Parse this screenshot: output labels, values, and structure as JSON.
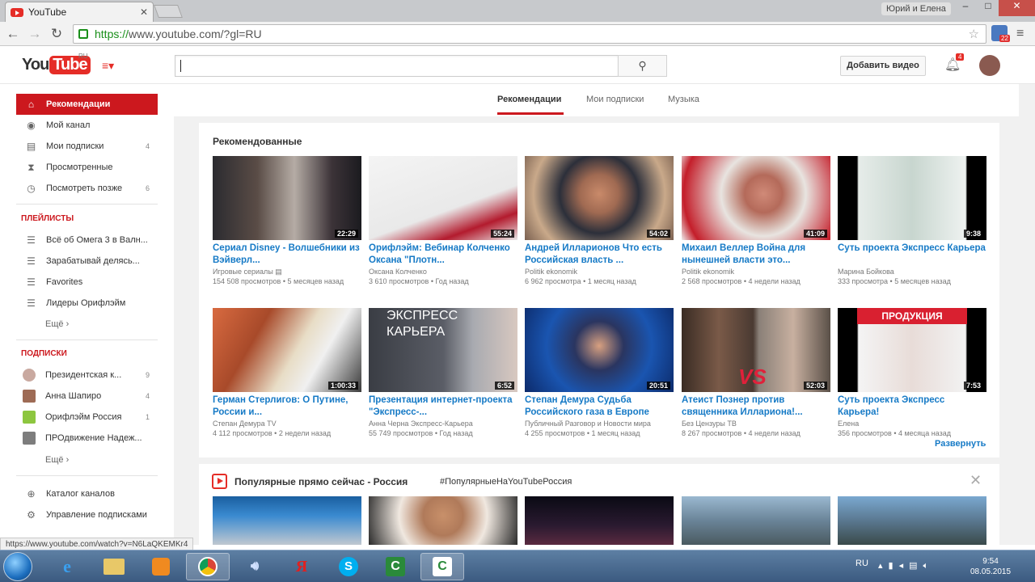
{
  "browser": {
    "tab_title": "YouTube",
    "tab_close": "✕",
    "user_chip": "Юрий и Елена",
    "url_https": "https://",
    "url_rest": "www.youtube.com/?gl=RU",
    "extension_badge": "22",
    "status_url": "https://www.youtube.com/watch?v=N6LaQKEMKr4"
  },
  "header": {
    "logo_you": "You",
    "logo_tube": "Tube",
    "logo_region": "RU",
    "search_value": "",
    "upload_label": "Добавить видео",
    "notification_count": "4"
  },
  "sidebar": {
    "main": [
      {
        "label": "Рекомендации",
        "icon": "home-icon",
        "count": ""
      },
      {
        "label": "Мой канал",
        "icon": "user-icon",
        "count": ""
      },
      {
        "label": "Мои подписки",
        "icon": "subscriptions-icon",
        "count": "4"
      },
      {
        "label": "Просмотренные",
        "icon": "hourglass-icon",
        "count": ""
      },
      {
        "label": "Посмотреть позже",
        "icon": "clock-icon",
        "count": "6"
      }
    ],
    "playlists_header": "ПЛЕЙЛИСТЫ",
    "playlists": [
      {
        "label": "Всё об Омега 3 в Валн...",
        "count": ""
      },
      {
        "label": "Зарабатывай делясь...",
        "count": ""
      },
      {
        "label": "Favorites",
        "count": ""
      },
      {
        "label": "Лидеры Орифлэйм",
        "count": ""
      }
    ],
    "more_label": "Ещё",
    "subs_header": "ПОДПИСКИ",
    "subscriptions": [
      {
        "label": "Президентская к...",
        "count": "9"
      },
      {
        "label": "Анна Шапиро",
        "count": "4"
      },
      {
        "label": "Орифлэйм Россия",
        "count": "1"
      },
      {
        "label": "ПРОдвижение Надеж...",
        "count": ""
      }
    ],
    "bottom": [
      {
        "label": "Каталог каналов",
        "icon": "add-icon"
      },
      {
        "label": "Управление подписками",
        "icon": "settings-icon"
      }
    ]
  },
  "feed_tabs": [
    "Рекомендации",
    "Мои подписки",
    "Музыка"
  ],
  "shelf1": {
    "title": "Рекомендованные",
    "expand_label": "Развернуть",
    "videos": [
      {
        "title": "Сериал Disney - Волшебники из Вэйверл...",
        "channel": "Игровые сериалы ▤",
        "views": "154 508 просмотров",
        "age": "• 5 месяцев назад",
        "duration": "22:29"
      },
      {
        "title": "Орифлэйм: Вебинар Колченко Оксана \"Плотн...",
        "channel": "Оксана Колченко",
        "views": "3 610 просмотров",
        "age": "• Год назад",
        "duration": "55:24"
      },
      {
        "title": "Андрей Илларионов Что есть Российская власть ...",
        "channel": "Politik ekonomik",
        "views": "6 962 просмотра",
        "age": "• 1 месяц назад",
        "duration": "54:02"
      },
      {
        "title": "Михаил Веллер Война для нынешней власти это...",
        "channel": "Politik ekonomik",
        "views": "2 568 просмотров",
        "age": "• 4 недели назад",
        "duration": "41:09"
      },
      {
        "title": "Суть проекта Экспресс Карьера",
        "channel": "Марина Бойкова",
        "views": "333 просмотра",
        "age": "• 5 месяцев назад",
        "duration": "9:38"
      },
      {
        "title": "Герман Стерлигов: О Путине, России и...",
        "channel": "Степан Демура TV",
        "views": "4 112 просмотров",
        "age": "• 2 недели назад",
        "duration": "1:00:33"
      },
      {
        "title": "Презентация интернет-проекта \"Экспресс-...",
        "channel": "Анна Черна Экспресс-Карьера",
        "views": "55 749 просмотров",
        "age": "• Год назад",
        "duration": "6:52"
      },
      {
        "title": "Степан Демура Судьба Российского газа в Европе",
        "channel": "Публичный Разговор и Новости мира",
        "views": "4 255 просмотров",
        "age": "• 1 месяц назад",
        "duration": "20:51"
      },
      {
        "title": "Атеист Познер против священника Илларионa!...",
        "channel": "Без Цензуры ТВ",
        "views": "8 267 просмотров",
        "age": "• 4 недели назад",
        "duration": "52:03"
      },
      {
        "title": "Суть проекта Экспресс Карьера!",
        "channel": "Елена",
        "views": "356 просмотров",
        "age": "• 4 месяца назад",
        "duration": "7:53"
      }
    ],
    "thumb_texts": {
      "express": "ЭКСПРЕСС\nКАРЬЕРА",
      "produkcia": "ПРОДУКЦИЯ",
      "vs": "VS"
    }
  },
  "shelf2": {
    "title": "Популярные прямо сейчас - Россия",
    "hashtag": "#ПопулярныеНаYouTubeРоссия",
    "close": "✕"
  },
  "taskbar": {
    "lang": "RU",
    "time": "9:54",
    "date": "08.05.2015",
    "apps": [
      "ie-icon",
      "explorer-icon",
      "media-player-icon",
      "chrome-icon",
      "audio-icon",
      "yandex-icon",
      "skype-icon",
      "camtasia-icon",
      "camtasia-recorder-icon"
    ]
  },
  "colors": {
    "brand": "#e52d27",
    "active_nav": "#cc181e",
    "link": "#167ac6"
  }
}
